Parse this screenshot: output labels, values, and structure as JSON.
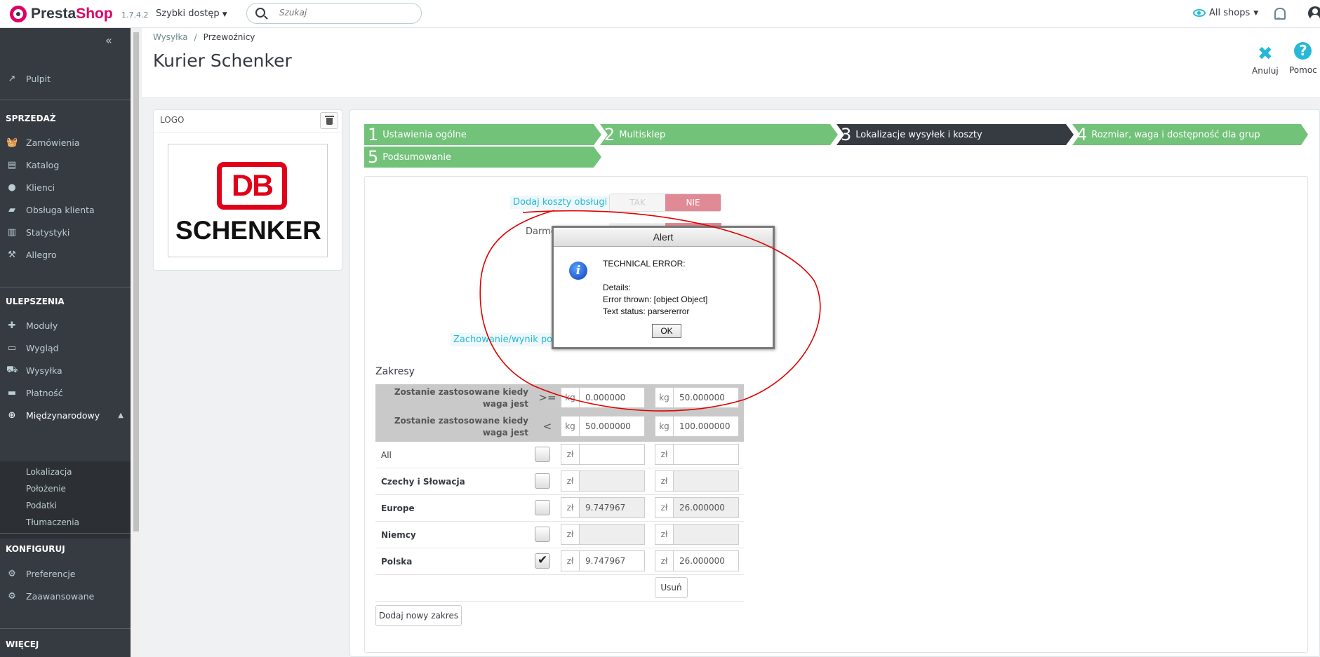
{
  "header": {
    "brand_presta": "Presta",
    "brand_shop": "Shop",
    "version": "1.7.4.2",
    "quick_access": "Szybki dostęp",
    "search_placeholder": "Szukaj",
    "shop_selector": "All shops"
  },
  "sidebar": {
    "dashboard": "Pulpit",
    "sections": {
      "sell": "SPRZEDAŻ",
      "improve": "ULEPSZENIA",
      "configure": "KONFIGURUJ",
      "more": "WIĘCEJ"
    },
    "sell_items": [
      "Zamówienia",
      "Katalog",
      "Klienci",
      "Obsługa klienta",
      "Statystyki",
      "Allegro"
    ],
    "improve_items": [
      "Moduły",
      "Wygląd",
      "Wysyłka",
      "Płatność",
      "Międzynarodowy"
    ],
    "international_sub": [
      "Lokalizacja",
      "Położenie",
      "Podatki",
      "Tłumaczenia"
    ],
    "configure_items": [
      "Preferencje",
      "Zaawansowane"
    ]
  },
  "page": {
    "breadcrumb": [
      "Wysyłka",
      "Przewoźnicy"
    ],
    "breadcrumb_sep": "/",
    "title": "Kurier Schenker",
    "toolbar": {
      "cancel": "Anuluj",
      "help": "Pomoc"
    }
  },
  "logo_panel": {
    "title": "LOGO",
    "logo_db": "DB",
    "logo_schenker": "SCHENKER"
  },
  "steps": [
    {
      "num": "1",
      "label": "Ustawienia ogólne"
    },
    {
      "num": "2",
      "label": "Multisklep"
    },
    {
      "num": "3",
      "label": "Lokalizacje wysyłek i koszty"
    },
    {
      "num": "4",
      "label": "Rozmiar, waga i dostępność dla grup"
    },
    {
      "num": "5",
      "label": "Podsumowanie"
    }
  ],
  "form": {
    "handling_label": "Dodaj koszty obsługi",
    "toggle_yes": "TAK",
    "toggle_no": "NIE",
    "free_label_partial": "Darmo",
    "behavior_label_partial": "Zachowanie/wynik poz",
    "ranges_title": "Zakresy",
    "range_rows": [
      {
        "label": "Zostanie zastosowane kiedy waga jest",
        "op": ">=",
        "unit": "kg",
        "from": "0.000000",
        "to": "50.000000"
      },
      {
        "label": "Zostanie zastosowane kiedy waga jest",
        "op": "<",
        "unit": "kg",
        "from": "50.000000",
        "to": "100.000000"
      }
    ],
    "currency": "zł",
    "zones": [
      {
        "name": "All",
        "checked": false,
        "p1": "",
        "p2": ""
      },
      {
        "name": "Czechy i Słowacja",
        "checked": false,
        "p1": "",
        "p2": ""
      },
      {
        "name": "Europe",
        "checked": false,
        "p1": "9.747967",
        "p2": "26.000000"
      },
      {
        "name": "Niemcy",
        "checked": false,
        "p1": "",
        "p2": ""
      },
      {
        "name": "Polska",
        "checked": true,
        "p1": "9.747967",
        "p2": "26.000000"
      }
    ],
    "delete_button": "Usuń",
    "add_range_button": "Dodaj nowy zakres"
  },
  "alert": {
    "title": "Alert",
    "message": "TECHNICAL ERROR:\n\nDetails:\nError thrown: [object Object]\nText status: parsererror",
    "ok": "OK"
  },
  "colors": {
    "brand_pink": "#df0067",
    "step_green": "#72c279",
    "step_active": "#363a41",
    "accent_blue": "#25b9d7",
    "annotation_red": "#e00000"
  }
}
